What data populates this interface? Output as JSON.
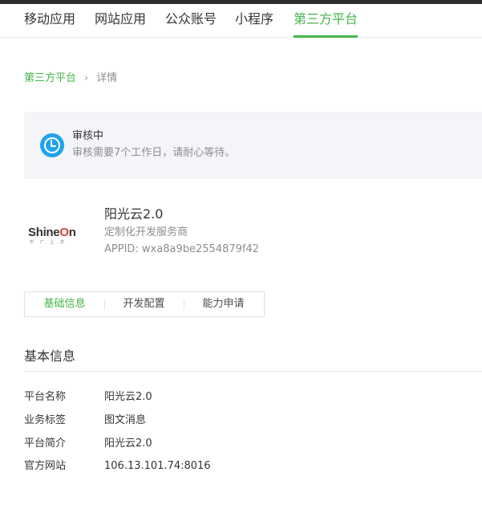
{
  "nav": {
    "items": [
      {
        "label": "移动应用"
      },
      {
        "label": "网站应用"
      },
      {
        "label": "公众账号"
      },
      {
        "label": "小程序"
      },
      {
        "label": "第三方平台"
      }
    ],
    "active_index": 4
  },
  "breadcrumb": {
    "parent": "第三方平台",
    "separator": "›",
    "current": "详情"
  },
  "notice": {
    "icon": "clock-icon",
    "title": "审核中",
    "description": "审核需要7个工作日，请耐心等待。"
  },
  "app": {
    "logo_text": "ShineOn",
    "logo_subtext": "中 广 上 洋",
    "name": "阳光云2.0",
    "type": "定制化开发服务商",
    "appid": "APPID: wxa8a9be2554879f42"
  },
  "tabs": {
    "items": [
      {
        "label": "基础信息"
      },
      {
        "label": "开发配置"
      },
      {
        "label": "能力申请"
      }
    ],
    "active_index": 0
  },
  "basic_info": {
    "title": "基本信息",
    "rows": [
      {
        "label": "平台名称",
        "value": "阳光云2.0"
      },
      {
        "label": "业务标签",
        "value": "图文消息"
      },
      {
        "label": "平台简介",
        "value": "阳光云2.0"
      },
      {
        "label": "官方网站",
        "value": "106.13.101.74:8016"
      }
    ]
  },
  "colors": {
    "accent": "#44b549",
    "notice_icon": "#1fa3ee",
    "topbar": "#2e2e2e"
  }
}
